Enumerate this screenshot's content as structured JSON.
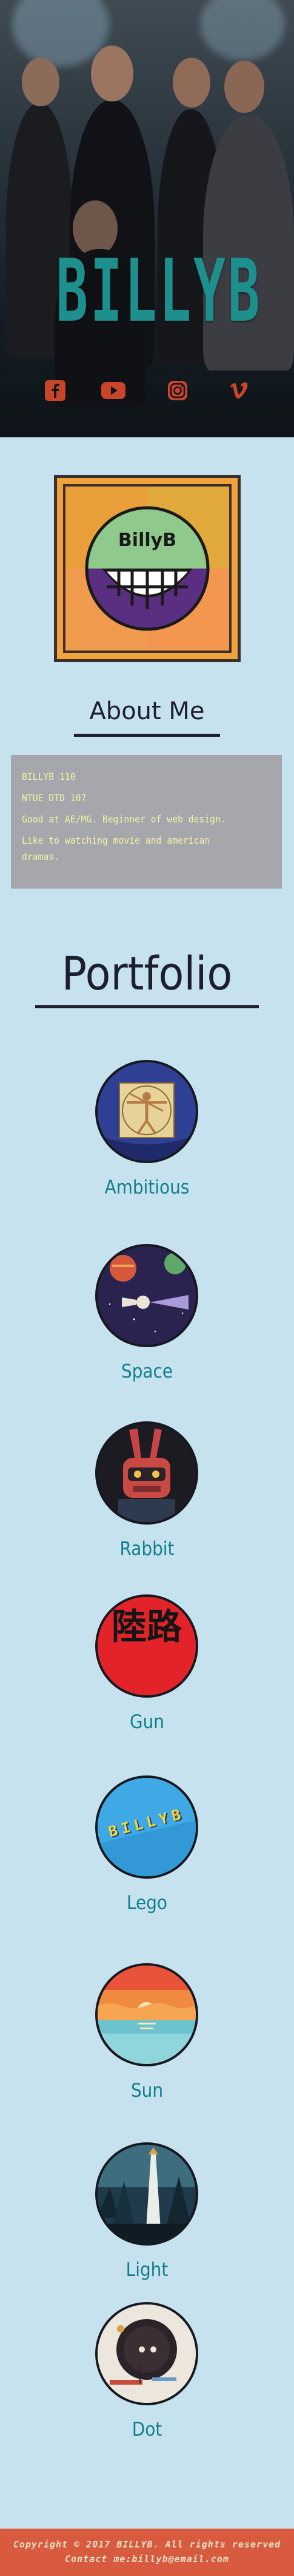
{
  "hero": {
    "brand": "BILLYB",
    "social": [
      {
        "icon": "facebook-icon",
        "label": "f"
      },
      {
        "icon": "youtube-icon",
        "label": "▶"
      },
      {
        "icon": "instagram-icon",
        "label": ""
      },
      {
        "icon": "vimeo-icon",
        "label": "v"
      }
    ],
    "accent": "#1d8f8c",
    "social_color": "#c8452c"
  },
  "logo": {
    "text": "BillyB",
    "border": "#3a2f2b"
  },
  "about": {
    "title": "About Me",
    "lines": [
      "BILLYB 110",
      "NTUE DTD 107",
      "Good at AE/MG. Beginner of web design.",
      "Like to watching movie and american dramas."
    ],
    "text_color": "#eef5a4",
    "box_color": "#a5a7ac"
  },
  "portfolio": {
    "title": "Portfolio",
    "items": [
      {
        "label": "Ambitious",
        "icon": "vitruvian-man-thumbnail"
      },
      {
        "label": "Space",
        "icon": "space-planet-thumbnail"
      },
      {
        "label": "Rabbit",
        "icon": "robot-rabbit-thumbnail"
      },
      {
        "label": "Gun",
        "icon": "red-calligraphy-thumbnail",
        "calligraphy": "陸路"
      },
      {
        "label": "Lego",
        "icon": "lego-text-thumbnail",
        "text": "BILLYB"
      },
      {
        "label": "Sun",
        "icon": "sunset-sea-thumbnail"
      },
      {
        "label": "Light",
        "icon": "lighthouse-forest-thumbnail"
      },
      {
        "label": "Dot",
        "icon": "dot-art-thumbnail"
      }
    ],
    "label_color": "#11808a"
  },
  "footer": {
    "copyright": "Copyright © 2017 BILLYB. All rights reserved",
    "contact": "Contact me:billyb@email.com",
    "color": "#d85a3f"
  }
}
